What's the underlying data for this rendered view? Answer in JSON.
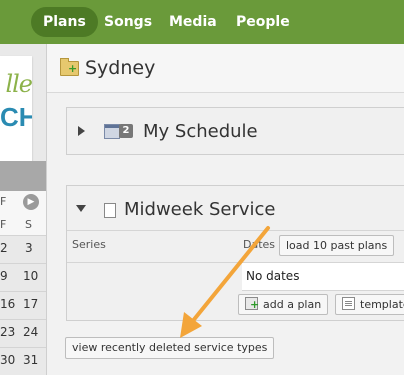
{
  "nav": {
    "items": [
      {
        "label": "Plans",
        "active": true
      },
      {
        "label": "Songs",
        "active": false
      },
      {
        "label": "Media",
        "active": false
      },
      {
        "label": "People",
        "active": false
      }
    ]
  },
  "sidebar": {
    "logo_top": "lle",
    "logo_bottom": "CH",
    "calendar": {
      "dow": [
        "F",
        "S"
      ],
      "rows": [
        [
          "2",
          "3"
        ],
        [
          "9",
          "10"
        ],
        [
          "16",
          "17"
        ],
        [
          "23",
          "24"
        ],
        [
          "30",
          "31"
        ]
      ],
      "next_glyph": "▶"
    }
  },
  "header": {
    "title": "Sydney"
  },
  "schedule_panel": {
    "badge": "2",
    "title": "My Schedule"
  },
  "service_panel": {
    "title": "Midweek Service",
    "series_label": "Series",
    "dates_label": "Dates",
    "load_past_label": "load 10 past plans",
    "no_dates": "No dates",
    "add_plan_label": "add a plan",
    "templates_label": "templates"
  },
  "footer": {
    "deleted_label": "view recently deleted service types"
  },
  "colors": {
    "nav_bg": "#6a9a3a",
    "nav_active": "#4d7a25",
    "arrow": "#f3a53a"
  }
}
